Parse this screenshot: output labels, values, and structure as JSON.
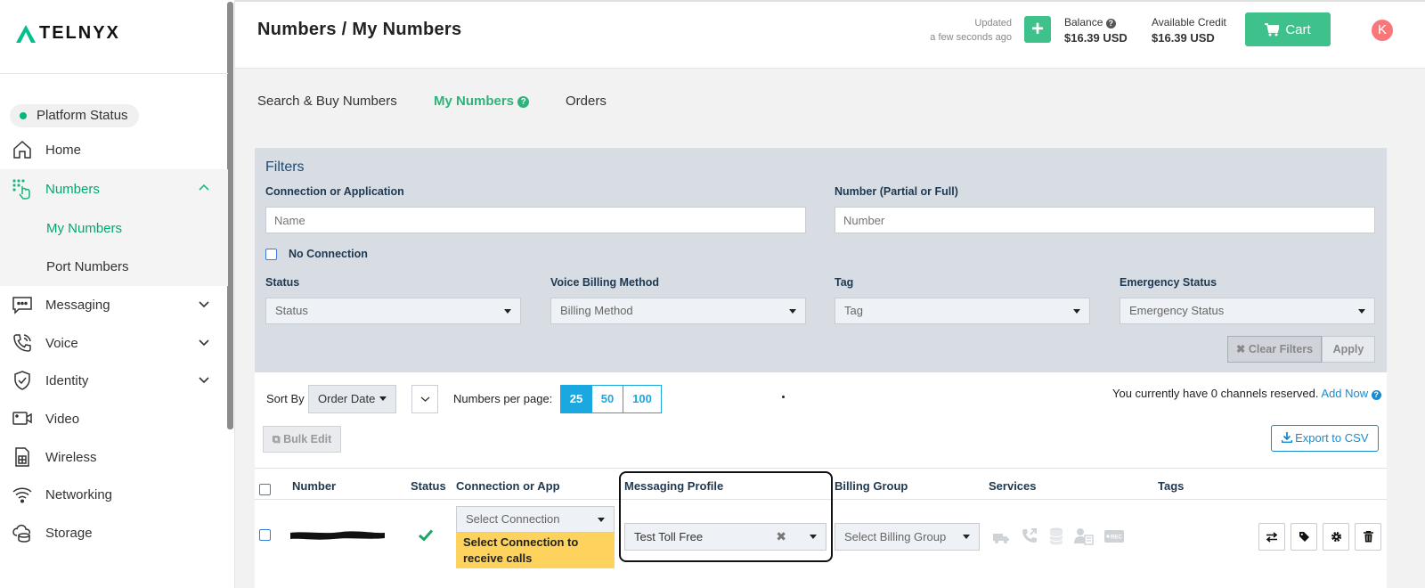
{
  "brand": {
    "logo_text": "TELNYX",
    "accent": "#3ec18a"
  },
  "sidebar": {
    "platform_status": "Platform Status",
    "items": [
      {
        "label": "Home",
        "icon": "home-icon"
      },
      {
        "label": "Numbers",
        "icon": "numbers-icon",
        "active": true
      },
      {
        "label": "Messaging",
        "icon": "messaging-icon"
      },
      {
        "label": "Voice",
        "icon": "phone-icon"
      },
      {
        "label": "Identity",
        "icon": "shield-icon"
      },
      {
        "label": "Video",
        "icon": "video-icon"
      },
      {
        "label": "Wireless",
        "icon": "sim-icon"
      },
      {
        "label": "Networking",
        "icon": "wifi-icon"
      },
      {
        "label": "Storage",
        "icon": "cloud-storage-icon"
      }
    ],
    "numbers_sub": [
      {
        "label": "My Numbers",
        "active": true
      },
      {
        "label": "Port Numbers"
      }
    ]
  },
  "header": {
    "title": "Numbers / My Numbers",
    "updated_label": "Updated",
    "updated_value": "a few seconds ago",
    "balance_label": "Balance",
    "balance_value": "$16.39 USD",
    "credit_label": "Available Credit",
    "credit_value": "$16.39 USD",
    "cart_label": "Cart",
    "avatar_initial": "K"
  },
  "tabs": [
    {
      "label": "Search & Buy Numbers"
    },
    {
      "label": "My Numbers",
      "active": true
    },
    {
      "label": "Orders"
    }
  ],
  "filters": {
    "title": "Filters",
    "connection_label": "Connection or Application",
    "connection_placeholder": "Name",
    "number_label": "Number (Partial or Full)",
    "number_placeholder": "Number",
    "no_connection_label": "No Connection",
    "status_label": "Status",
    "status_value": "Status",
    "billing_label": "Voice Billing Method",
    "billing_value": "Billing Method",
    "tag_label": "Tag",
    "tag_value": "Tag",
    "emergency_label": "Emergency Status",
    "emergency_value": "Emergency Status",
    "clear_label": "Clear Filters",
    "apply_label": "Apply"
  },
  "toolbar": {
    "sort_by_label": "Sort By",
    "sort_value": "Order Date",
    "per_page_label": "Numbers per page:",
    "per_page_options": [
      "25",
      "50",
      "100"
    ],
    "per_page_selected": "25",
    "channels_text": "You currently have 0 channels reserved.",
    "add_now_label": "Add Now",
    "bulk_edit_label": "Bulk Edit",
    "export_label": "Export to CSV"
  },
  "table": {
    "columns": [
      "Number",
      "Status",
      "Connection or App",
      "Messaging Profile",
      "Billing Group",
      "Services",
      "Tags"
    ],
    "rows": [
      {
        "number": "",
        "status": "active",
        "connection_placeholder": "Select Connection",
        "connection_warning": "Select Connection to receive calls",
        "messaging_profile": "Test Toll Free",
        "billing_group_placeholder": "Select Billing Group"
      }
    ]
  }
}
